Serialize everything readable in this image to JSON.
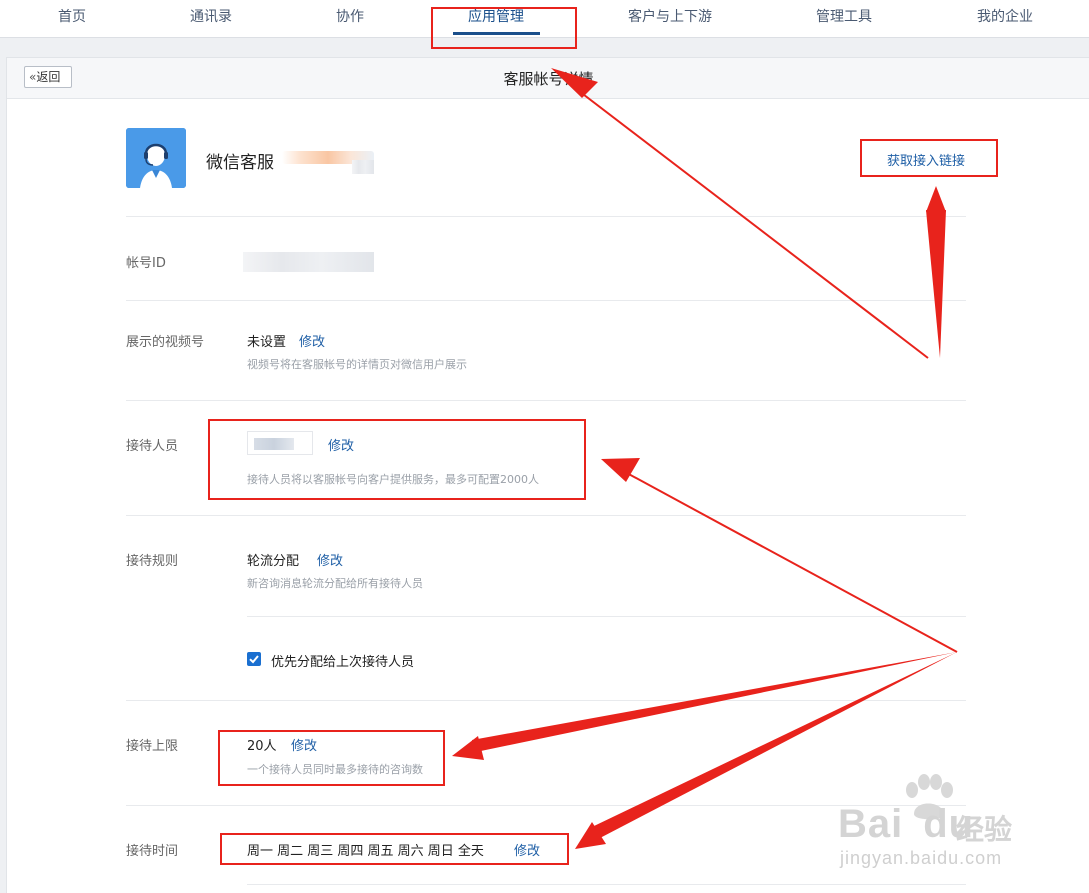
{
  "topnav": {
    "items": [
      {
        "label": "首页"
      },
      {
        "label": "通讯录"
      },
      {
        "label": "协作"
      },
      {
        "label": "应用管理",
        "active": true
      },
      {
        "label": "客户与上下游"
      },
      {
        "label": "管理工具"
      },
      {
        "label": "我的企业"
      }
    ]
  },
  "header": {
    "back_label": "返回",
    "title": "客服帐号详情"
  },
  "account": {
    "name": "微信客服",
    "get_link_label": "获取接入链接"
  },
  "fields": {
    "account_id": {
      "label": "帐号ID"
    },
    "video_channel": {
      "label": "展示的视频号",
      "value": "未设置",
      "edit": "修改",
      "desc": "视频号将在客服帐号的详情页对微信用户展示"
    },
    "reception_staff": {
      "label": "接待人员",
      "edit": "修改",
      "desc": "接待人员将以客服帐号向客户提供服务，最多可配置2000人"
    },
    "reception_rule": {
      "label": "接待规则",
      "value": "轮流分配",
      "edit": "修改",
      "desc": "新咨询消息轮流分配给所有接待人员",
      "priority_checkbox_label": "优先分配给上次接待人员",
      "priority_checked": true
    },
    "reception_limit": {
      "label": "接待上限",
      "value": "20人",
      "edit": "修改",
      "desc": "一个接待人员同时最多接待的咨询数"
    },
    "reception_time": {
      "label": "接待时间",
      "value": "周一 周二 周三 周四 周五 周六 周日 全天",
      "edit": "修改"
    }
  },
  "watermark": {
    "brand": "Bai",
    "brand_tail": "du",
    "cn": "经验",
    "url": "jingyan.baidu.com"
  },
  "colors": {
    "accent": "#1a4f8b",
    "link": "#1f5fa6",
    "annotation": "#e8231c",
    "checkbox": "#1a6fd0"
  }
}
